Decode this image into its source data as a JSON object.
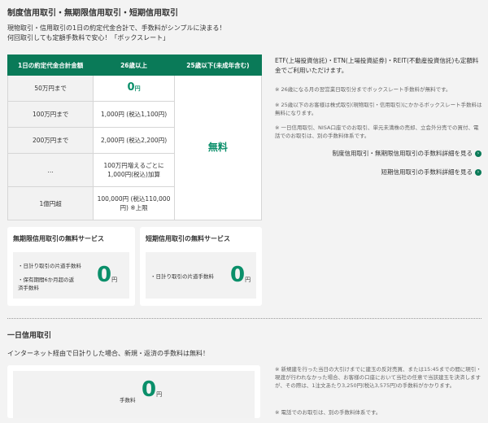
{
  "section1": {
    "title": "制度信用取引・無期限信用取引・短期信用取引",
    "intro1": "現物取引・信用取引の1日の約定代金合計で、手数料がシンプルに決まる！",
    "intro2": "何回取引しても定額手数料で安心！「ボックスレート」"
  },
  "table": {
    "headers": [
      "1日の約定代金合計金額",
      "26歳以上",
      "25歳以下(未成年含む)"
    ],
    "rows": [
      {
        "label": "50万円まで",
        "fee_num": "0",
        "fee_unit": "円"
      },
      {
        "label": "100万円まで",
        "fee": "1,000円 (税込1,100円)"
      },
      {
        "label": "200万円まで",
        "fee": "2,000円 (税込2,200円)"
      },
      {
        "label": "…",
        "fee": "100万円増えるごとに1,000円(税込)加算"
      },
      {
        "label": "1億円超",
        "fee": "100,000円 (税込110,000円) ※上限"
      }
    ],
    "young_fee": "無料"
  },
  "right": {
    "etf_text": "ETF(上場投資信託)・ETN(上場投資証券)・REIT(不動産投資信託)も定額料金でご利用いただけます。",
    "note1": "※ 26歳になる月の翌営業日取引分までボックスレート手数料が無料です。",
    "note2": "※ 25歳以下のお客様は株式取引(現物取引・信用取引)にかかるボックスレート手数料は無料になります。",
    "note3": "※ 一日信用取引、NISA口座でのお取引、単元未満株の売却、立会外分売での買付、電話でのお取引は、別の手数料体系です。",
    "link1": "制度信用取引・無期限信用取引の手数料詳細を見る",
    "link2": "短期信用取引の手数料詳細を見る"
  },
  "card_mukigen": {
    "title": "無期限信用取引の無料サービス",
    "item1": "・日計り取引の片道手数料",
    "item2": "・保有期間6か月超の返済手数料",
    "amount": "0",
    "unit": "円"
  },
  "card_tanki": {
    "title": "短期信用取引の無料サービス",
    "item1": "・日計り取引の片道手数料",
    "amount": "0",
    "unit": "円"
  },
  "section2": {
    "title": "一日信用取引",
    "desc": "インターネット経由で日計りした場合、新規・返済の手数料は無料！",
    "fee_label": "手数料",
    "amount": "0",
    "unit": "円",
    "note1": "※ 新規建を行った当日の大引けまでに建玉の反対売買、または15:45までの間に現引・現渡が行われなかった場合、お客様の口座において当社の任意で当該建玉を決済しますが、その際は、1注文あたり3,250円(税込3,575円)の手数料がかかります。",
    "note2": "※ 電話でのお取引は、別の手数料体系です。"
  }
}
